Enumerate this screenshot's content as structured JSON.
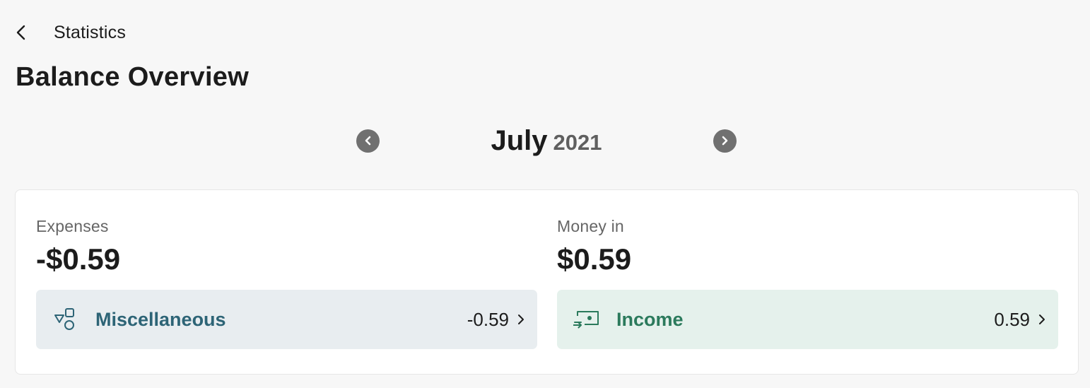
{
  "header": {
    "back_label": "Statistics",
    "title": "Balance Overview"
  },
  "period": {
    "month": "July",
    "year": "2021"
  },
  "summary": {
    "expenses": {
      "label": "Expenses",
      "amount": "-$0.59",
      "category": {
        "name": "Miscellaneous",
        "value": "-0.59",
        "icon": "shapes-icon",
        "color": "#2d6476"
      }
    },
    "money_in": {
      "label": "Money in",
      "amount": "$0.59",
      "category": {
        "name": "Income",
        "value": "0.59",
        "icon": "cash-in-icon",
        "color": "#2b7a5c"
      }
    }
  }
}
